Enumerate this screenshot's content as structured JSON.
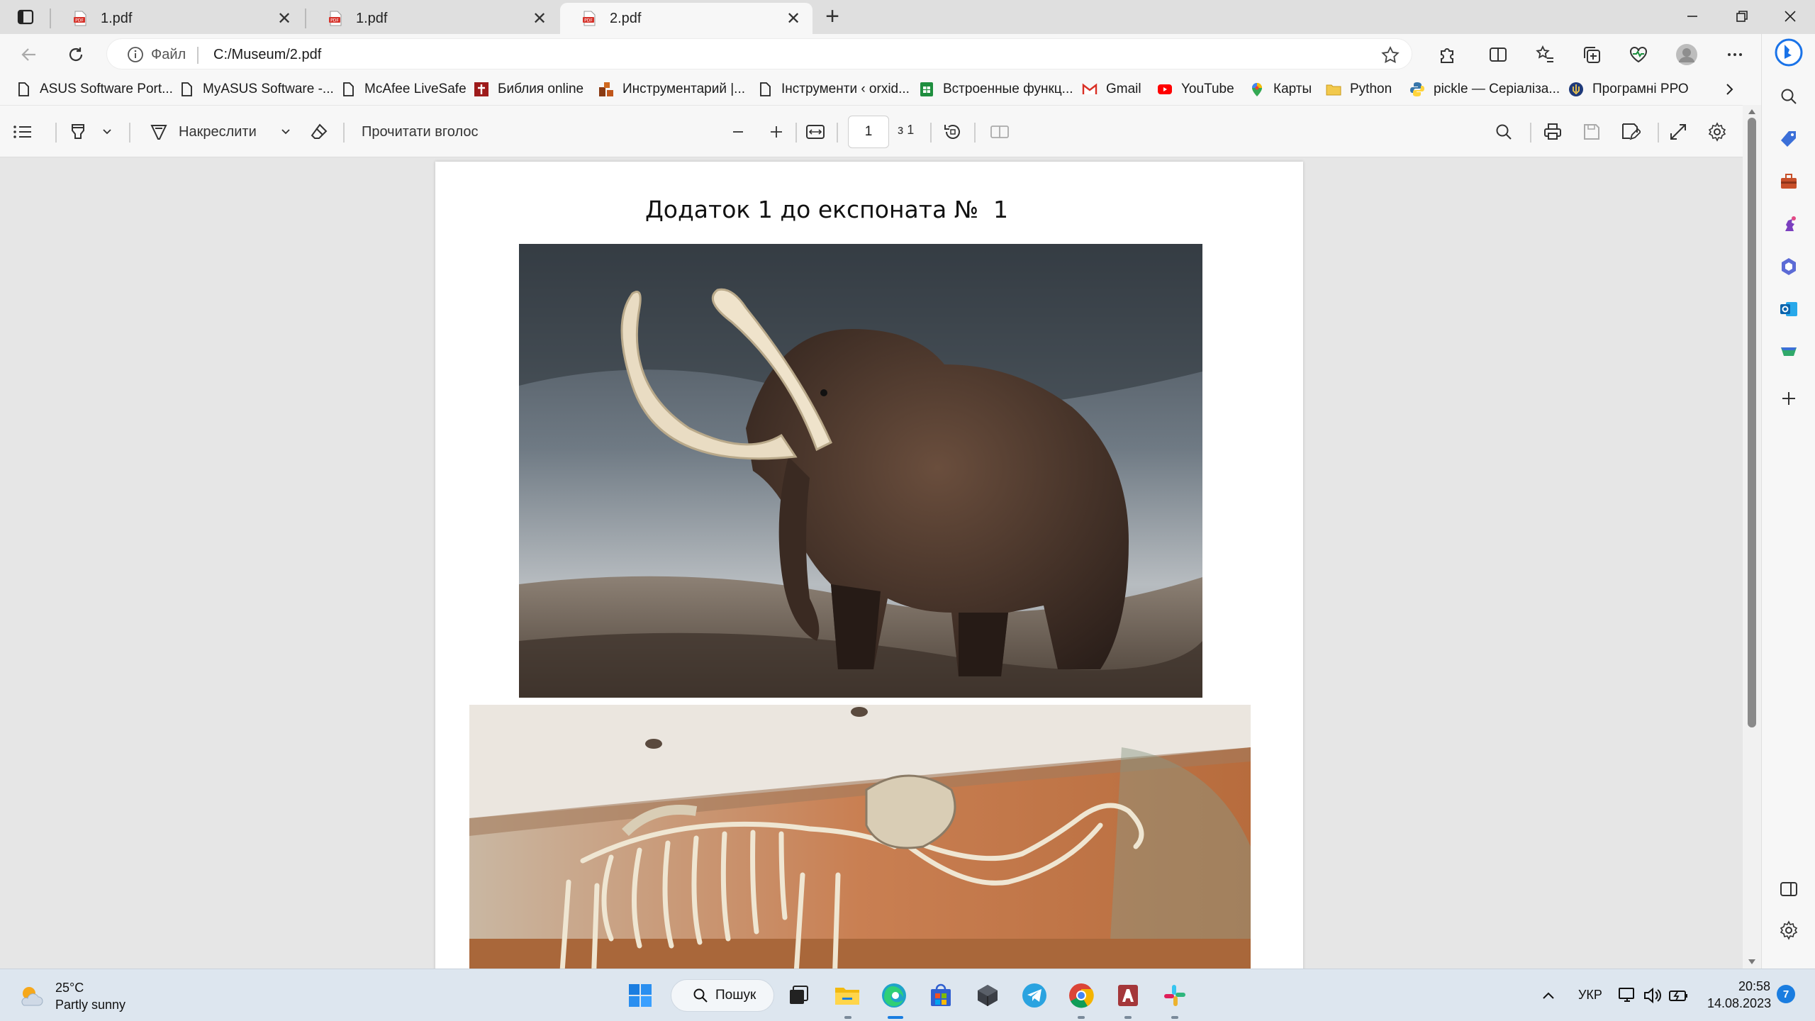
{
  "tabs": [
    {
      "title": "1.pdf",
      "active": false
    },
    {
      "title": "1.pdf",
      "active": false
    },
    {
      "title": "2.pdf",
      "active": true
    }
  ],
  "address": {
    "scheme_label": "Файл",
    "url": "C:/Museum/2.pdf"
  },
  "favorites": [
    {
      "label": "ASUS Software Port...",
      "icon": "page-icon"
    },
    {
      "label": "MyASUS Software -...",
      "icon": "page-icon"
    },
    {
      "label": "McAfee LiveSafe",
      "icon": "page-icon"
    },
    {
      "label": "Библия online",
      "icon": "bible-cross-icon"
    },
    {
      "label": "Инструментарий |...",
      "icon": "blocks-icon"
    },
    {
      "label": "Інструменти ‹ orxid...",
      "icon": "page-icon"
    },
    {
      "label": "Встроенные функц...",
      "icon": "sheet-icon"
    },
    {
      "label": "Gmail",
      "icon": "gmail-icon"
    },
    {
      "label": "YouTube",
      "icon": "youtube-icon"
    },
    {
      "label": "Карты",
      "icon": "maps-pin-icon"
    },
    {
      "label": "Python",
      "icon": "folder-icon"
    },
    {
      "label": "pickle — Серіаліза...",
      "icon": "python-icon"
    },
    {
      "label": "Програмні РРО",
      "icon": "ua-emblem-icon"
    }
  ],
  "pdf_toolbar": {
    "draw_label": "Накреслити",
    "read_aloud_label": "Прочитати вголос",
    "page_current": "1",
    "page_total": "з 1"
  },
  "document": {
    "title": "Додаток 1 до експоната №  1"
  },
  "taskbar": {
    "weather_temp": "25°C",
    "weather_desc": "Partly sunny",
    "search_label": "Пошук",
    "language": "УКР",
    "time": "20:58",
    "date": "14.08.2023",
    "notification_count": "7"
  },
  "colors": {
    "accent": "#0078d4",
    "pdf_red": "#d6332b",
    "taskbar_bg": "#dde6ef"
  }
}
